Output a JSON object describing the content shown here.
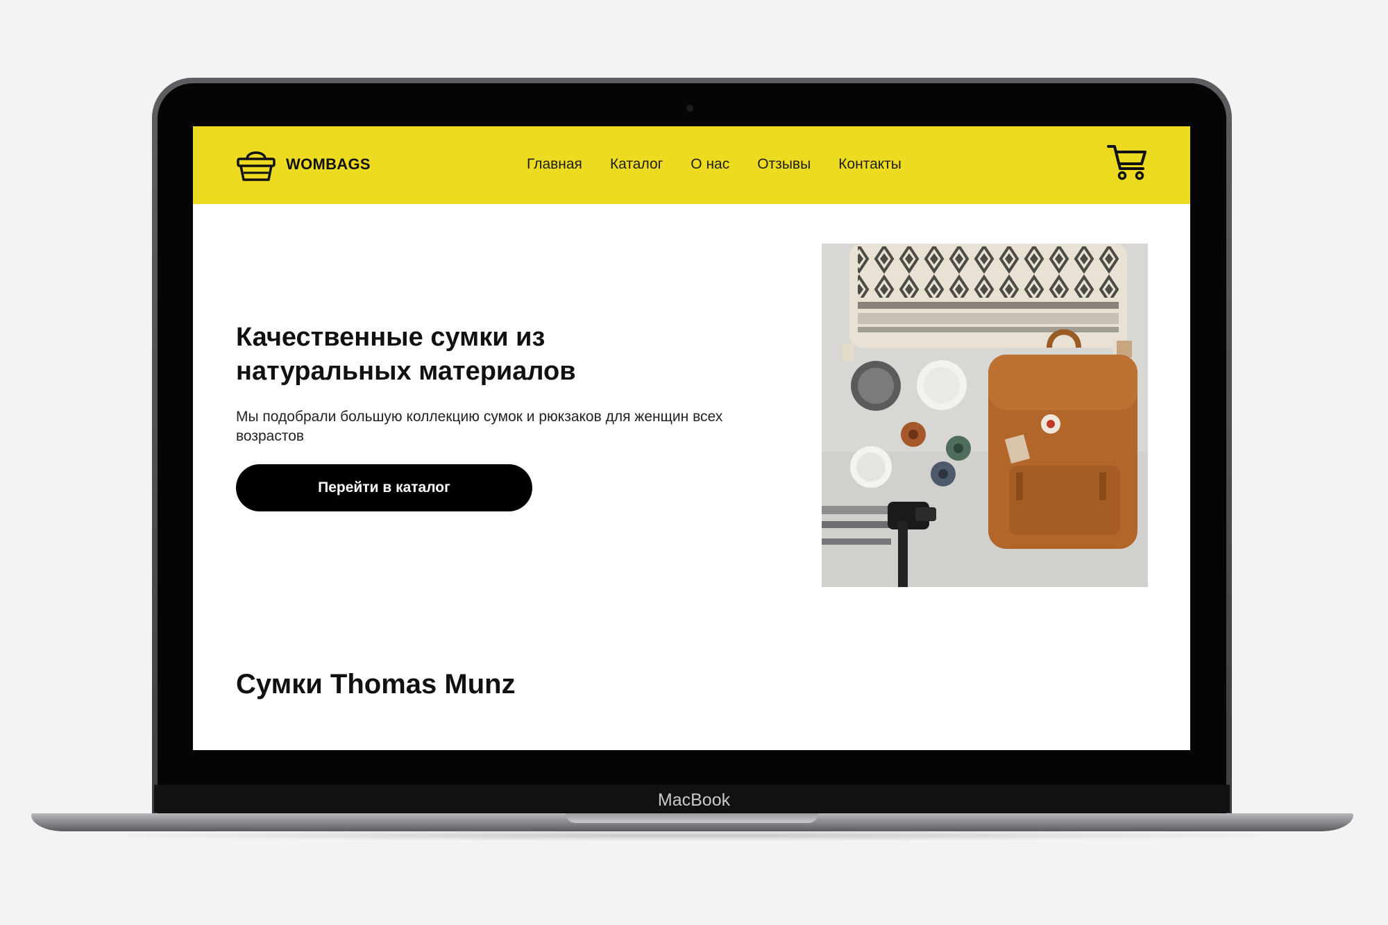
{
  "device": {
    "brand_label": "MacBook"
  },
  "header": {
    "logo_text": "WOMBAGS",
    "nav": [
      "Главная",
      "Каталог",
      "О нас",
      "Отзывы",
      "Контакты"
    ],
    "cart_icon": "shopping-cart-icon",
    "logo_icon": "basket-icon",
    "accent_color": "#ecdb20"
  },
  "hero": {
    "title": "Качественные сумки из натуральных материалов",
    "subtitle": "Мы подобрали большую коллекцию сумок и рюкзаков для женщин всех возрастов",
    "cta_label": "Перейти в каталог"
  },
  "section": {
    "title": "Сумки Thomas Munz"
  }
}
